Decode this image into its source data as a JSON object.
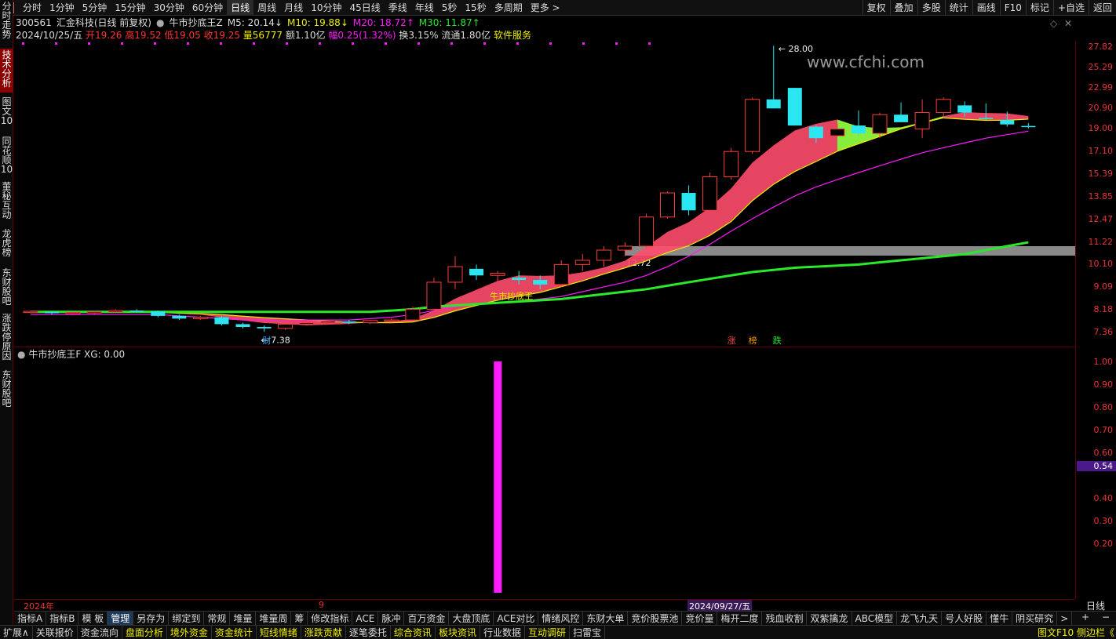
{
  "periods": [
    "分时",
    "1分钟",
    "5分钟",
    "15分钟",
    "30分钟",
    "60分钟",
    "日线",
    "周线",
    "月线",
    "10分钟",
    "45日线",
    "季线",
    "年线",
    "5秒",
    "15秒",
    "多周期",
    "更多 >"
  ],
  "active_period": "日线",
  "right_tools": [
    "复权",
    "叠加",
    "多股",
    "统计",
    "画线",
    "F10",
    "标记",
    "+自选",
    "返回"
  ],
  "side_tabs": [
    {
      "label": "分时走势",
      "active": false
    },
    {
      "label": "技术分析",
      "active": true
    },
    {
      "label": "图文10",
      "active": false
    },
    {
      "label": "同花顺10",
      "active": false
    },
    {
      "label": "董秘互动",
      "active": false
    },
    {
      "label": "龙虎榜",
      "active": false
    },
    {
      "label": "东财股吧",
      "active": false
    },
    {
      "label": "涨跌停原因",
      "active": false
    },
    {
      "label": "东财股吧",
      "active": false
    }
  ],
  "stock": {
    "code": "300561",
    "name": "汇金科技(日线 前复权)",
    "indicator": "牛市抄底王Z"
  },
  "ma": {
    "m5": "M5: 20.14↓",
    "m10": "M10: 19.88↓",
    "m20": "M20: 18.72↑",
    "m30": "M30: 11.87↑"
  },
  "quote": {
    "date": "2024/10/25/五",
    "open": "开19.26",
    "high": "高19.52",
    "low": "低19.05",
    "close": "收19.25",
    "vol": "量56777",
    "amt": "额1.10亿",
    "chg": "幅0.25(1.32%)",
    "turn": "换3.15%",
    "float": "流通1.80亿",
    "service": "软件服务"
  },
  "watermark": "www.cfchi.com",
  "annotations": {
    "high": "28.00",
    "low": "7.38",
    "band": "12.72",
    "signal": "牛市抄底王",
    "cai": "财",
    "zhang": "涨",
    "bang": "榜",
    "die": "跌"
  },
  "price_axis": [
    "27.82",
    "25.29",
    "22.99",
    "20.90",
    "19.00",
    "17.10",
    "15.39",
    "13.85",
    "12.47",
    "11.22",
    "10.10",
    "9.09",
    "8.18",
    "7.36"
  ],
  "sub": {
    "title": "牛市抄底王F",
    "xg": "XG: 0.00",
    "axis": [
      "1.00",
      "0.90",
      "0.80",
      "0.70",
      "0.60",
      "0.54",
      "0.40",
      "0.30",
      "0.20"
    ],
    "cur": "0.54"
  },
  "dates": {
    "start": "2024年",
    "mid": "9",
    "sel": "2024/09/27/五"
  },
  "period_label": "日线",
  "indicator_tabs": [
    "指标A",
    "指标B",
    "模 板",
    "管理",
    "另存为",
    "绑定到",
    "常规",
    "堆量",
    "堆量周",
    "筹",
    "修改指标",
    "ACE",
    "脉冲",
    "百万资金",
    "大盘顶底",
    "ACE对比",
    "情绪风控",
    "东财大单",
    "竞价股票池",
    "竞价量",
    "梅开二度",
    "残血收割",
    "双紫擒龙",
    "ABC模型",
    "龙飞九天",
    "号人好股",
    "懂牛",
    "阴买研究",
    ">"
  ],
  "active_indicator": "管理",
  "bottom_tabs": [
    {
      "label": "扩展∧",
      "y": false
    },
    {
      "label": "关联报价",
      "y": false
    },
    {
      "label": "资金流向",
      "y": false
    },
    {
      "label": "盘面分析",
      "y": true
    },
    {
      "label": "境外资金",
      "y": true
    },
    {
      "label": "资金统计",
      "y": true
    },
    {
      "label": "短线情绪",
      "y": true
    },
    {
      "label": "涨跌贡献",
      "y": true
    },
    {
      "label": "逐笔委托",
      "y": false
    },
    {
      "label": "综合资讯",
      "y": true
    },
    {
      "label": "板块资讯",
      "y": true
    },
    {
      "label": "行业数据",
      "y": false
    },
    {
      "label": "互动调研",
      "y": true
    },
    {
      "label": "扫雷宝",
      "y": false
    }
  ],
  "bottom_right": "图文F10 侧边栏《",
  "colors": {
    "up": "#ff3b3b",
    "down": "#29e6f0",
    "ribbon_up": "#ff4d6d",
    "ribbon_dn": "#7cff3a",
    "band": "#8a8a8a",
    "magenta": "#ff1aff",
    "green": "#2be82b"
  },
  "chart_data": {
    "type": "candlestick",
    "candles": [
      [
        8.1,
        8.15,
        8.05,
        8.12
      ],
      [
        8.1,
        8.12,
        8.0,
        8.05
      ],
      [
        8.05,
        8.1,
        8.0,
        8.08
      ],
      [
        8.08,
        8.12,
        8.02,
        8.1
      ],
      [
        8.1,
        8.2,
        8.05,
        8.15
      ],
      [
        8.15,
        8.2,
        8.1,
        8.12
      ],
      [
        8.12,
        8.15,
        7.9,
        7.95
      ],
      [
        7.95,
        8.0,
        7.8,
        7.85
      ],
      [
        7.85,
        7.95,
        7.8,
        7.9
      ],
      [
        7.9,
        7.95,
        7.6,
        7.65
      ],
      [
        7.65,
        7.7,
        7.5,
        7.55
      ],
      [
        7.55,
        7.6,
        7.38,
        7.5
      ],
      [
        7.5,
        7.7,
        7.45,
        7.65
      ],
      [
        7.65,
        7.75,
        7.6,
        7.7
      ],
      [
        7.7,
        7.8,
        7.65,
        7.75
      ],
      [
        7.75,
        7.8,
        7.65,
        7.7
      ],
      [
        7.7,
        7.8,
        7.65,
        7.78
      ],
      [
        7.78,
        7.85,
        7.7,
        7.8
      ],
      [
        7.8,
        8.3,
        7.75,
        8.2
      ],
      [
        8.2,
        9.5,
        8.1,
        9.3
      ],
      [
        9.3,
        10.5,
        9.0,
        10.0
      ],
      [
        9.9,
        10.1,
        9.4,
        9.6
      ],
      [
        9.6,
        9.8,
        9.3,
        9.7
      ],
      [
        9.5,
        9.8,
        9.2,
        9.4
      ],
      [
        9.4,
        9.6,
        9.0,
        9.2
      ],
      [
        9.2,
        10.3,
        9.1,
        10.1
      ],
      [
        10.1,
        10.6,
        9.8,
        10.3
      ],
      [
        10.3,
        11.0,
        10.0,
        10.8
      ],
      [
        10.8,
        11.2,
        10.5,
        11.0
      ],
      [
        11.0,
        12.8,
        10.9,
        12.6
      ],
      [
        12.6,
        14.2,
        12.5,
        14.1
      ],
      [
        14.1,
        14.6,
        12.7,
        13.0
      ],
      [
        13.0,
        15.5,
        12.9,
        15.2
      ],
      [
        15.2,
        17.4,
        15.0,
        17.1
      ],
      [
        17.1,
        22.0,
        16.9,
        21.8
      ],
      [
        21.8,
        28.0,
        20.9,
        20.9
      ],
      [
        23.0,
        23.0,
        19.3,
        19.3
      ],
      [
        19.2,
        19.3,
        17.8,
        18.2
      ],
      [
        18.4,
        19.5,
        18.4,
        19.0
      ],
      [
        19.3,
        20.7,
        18.4,
        18.6
      ],
      [
        18.6,
        20.5,
        18.2,
        20.3
      ],
      [
        20.3,
        21.5,
        19.8,
        19.6
      ],
      [
        19.0,
        21.8,
        18.2,
        20.5
      ],
      [
        20.5,
        22.0,
        20.0,
        21.8
      ],
      [
        21.2,
        21.6,
        20.1,
        20.5
      ],
      [
        20.0,
        21.4,
        19.8,
        19.9
      ],
      [
        19.8,
        20.6,
        19.2,
        19.4
      ],
      [
        19.26,
        19.52,
        19.05,
        19.25
      ]
    ],
    "ma30": [
      8.1,
      8.1,
      8.1,
      8.1,
      8.1,
      8.1,
      8.1,
      8.1,
      8.1,
      8.1,
      8.1,
      8.1,
      8.1,
      8.1,
      8.1,
      8.1,
      8.1,
      8.15,
      8.2,
      8.3,
      8.35,
      8.4,
      8.45,
      8.5,
      8.55,
      8.6,
      8.7,
      8.8,
      8.9,
      9.0,
      9.15,
      9.3,
      9.45,
      9.6,
      9.75,
      9.85,
      9.95,
      10.0,
      10.05,
      10.1,
      10.2,
      10.3,
      10.4,
      10.5,
      10.6,
      10.8,
      11.0,
      11.2
    ],
    "ma20": [
      8.0,
      8.0,
      8.0,
      8.0,
      8.0,
      8.0,
      8.0,
      7.95,
      7.9,
      7.85,
      7.8,
      7.8,
      7.8,
      7.8,
      7.8,
      7.8,
      7.85,
      7.9,
      8.0,
      8.15,
      8.3,
      8.4,
      8.45,
      8.5,
      8.6,
      8.7,
      8.9,
      9.1,
      9.3,
      9.6,
      10.0,
      10.5,
      11.1,
      11.8,
      12.5,
      13.2,
      13.9,
      14.5,
      15.0,
      15.5,
      16.0,
      16.5,
      17.0,
      17.4,
      17.8,
      18.2,
      18.5,
      18.8
    ],
    "xg_index": 22
  }
}
